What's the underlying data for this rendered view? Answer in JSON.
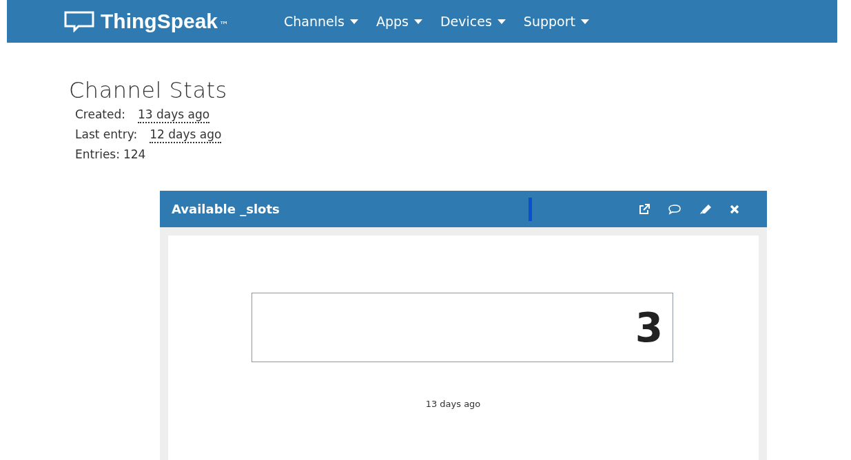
{
  "navbar": {
    "brand": "ThingSpeak",
    "trademark": "™",
    "menus": [
      {
        "label": "Channels"
      },
      {
        "label": "Apps"
      },
      {
        "label": "Devices"
      },
      {
        "label": "Support"
      }
    ]
  },
  "stats": {
    "title": "Channel Stats",
    "rows": [
      {
        "kind": "link",
        "label": "Created:",
        "value": "13 days ago"
      },
      {
        "kind": "link",
        "label": "Last entry:",
        "value": "12 days ago"
      },
      {
        "kind": "plain",
        "label": "Entries:",
        "value": "124"
      }
    ]
  },
  "widget": {
    "title": "Available _slots",
    "value": "3",
    "timestamp": "13 days ago"
  }
}
